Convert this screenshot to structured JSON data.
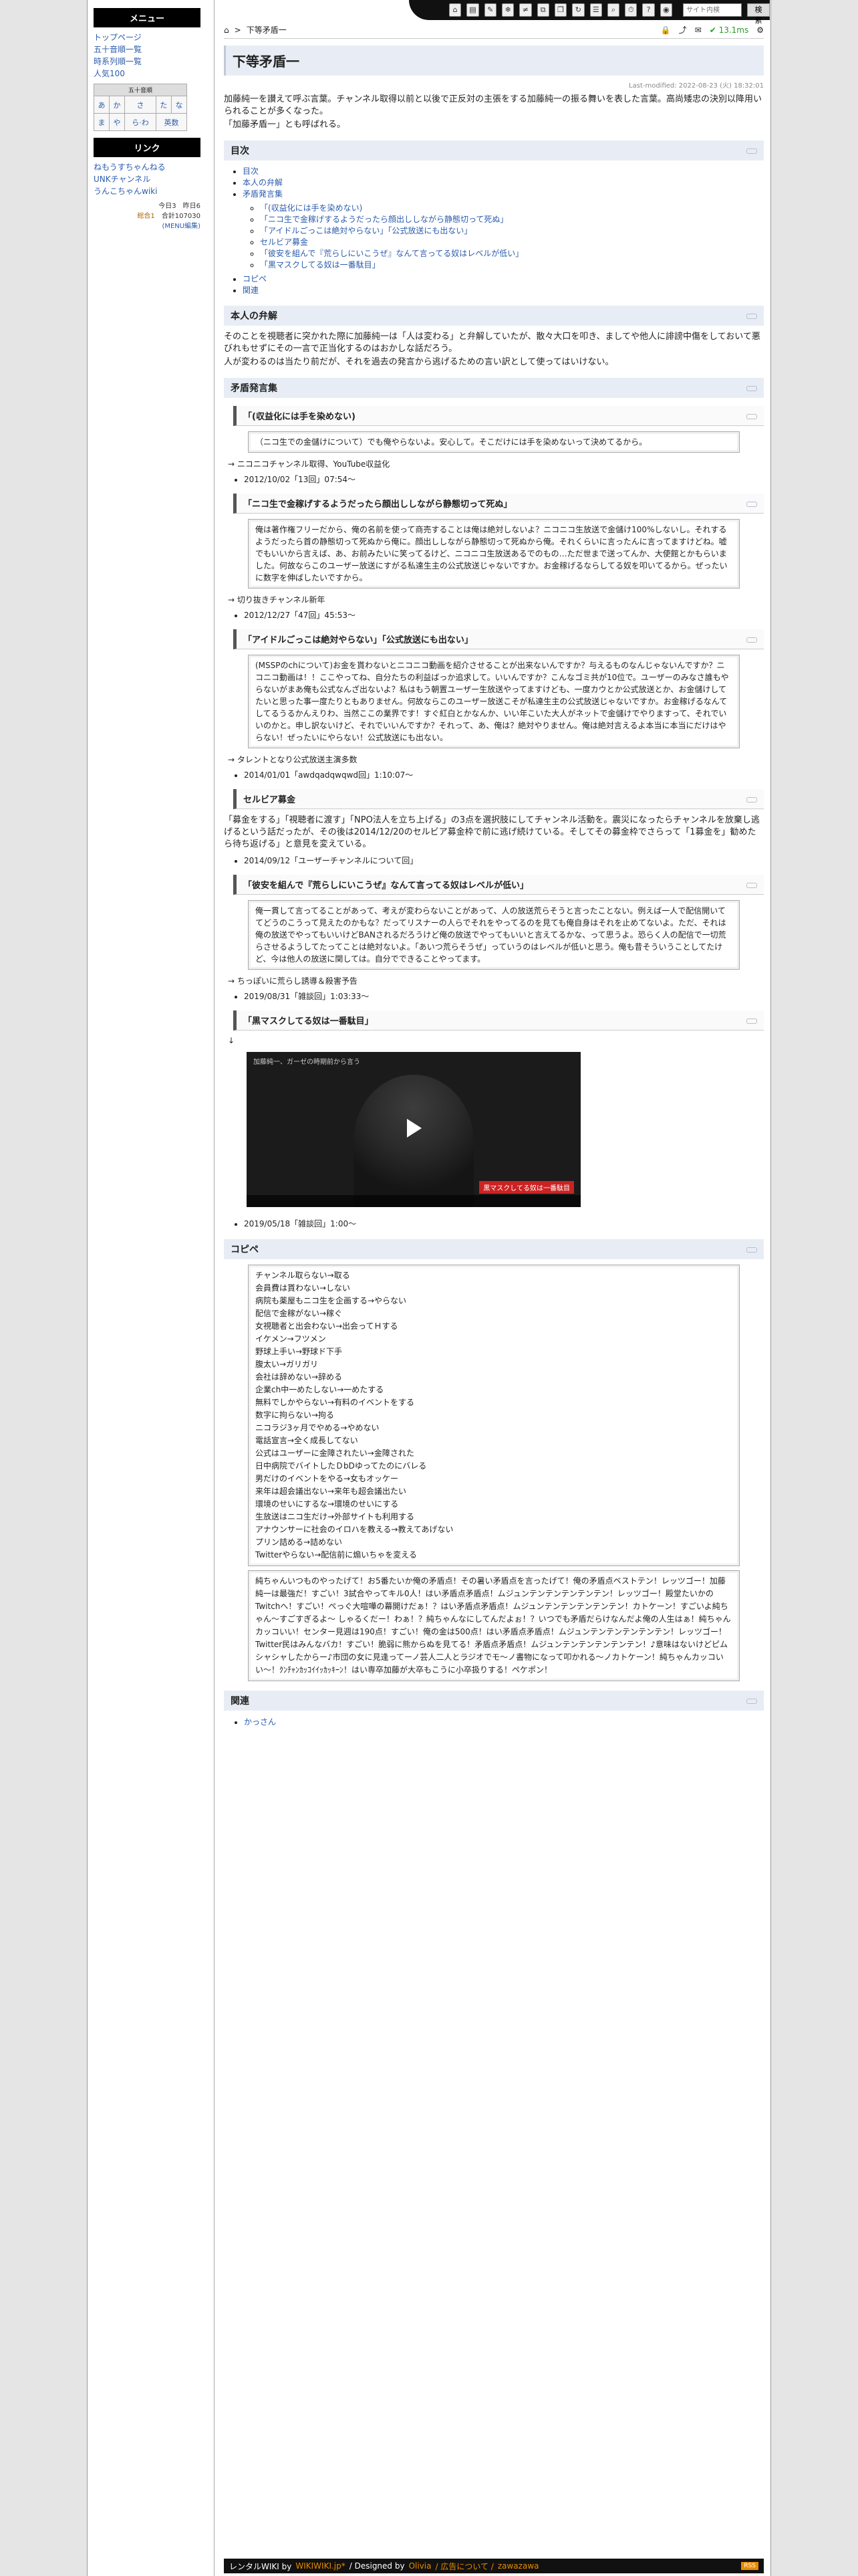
{
  "sidebar": {
    "menu_title": "メニュー",
    "menu_items": [
      "トップページ",
      "五十音順一覧",
      "時系列順一覧",
      "人気100"
    ],
    "kana_caption": "五十音順",
    "kana_rows": [
      [
        "あ",
        "か",
        "さ",
        "た",
        "な"
      ],
      [
        "ま",
        "や",
        "ら·わ",
        "英数"
      ]
    ],
    "links_title": "リンク",
    "link_items": [
      "ねもうすちゃんねる",
      "UNKチャンネル",
      "うんこちゃんwiki"
    ],
    "counter_today": "今日3　昨日6",
    "counter_total_label": "総合1",
    "counter_total": "合計107030",
    "menu_edit": "(MENU編集)"
  },
  "toolbar": {
    "search_placeholder": "サイト内検",
    "search_button": "検索"
  },
  "header": {
    "breadcrumb_sep": ">",
    "breadcrumb_page": "下等矛盾一",
    "response": "13.1ms"
  },
  "page": {
    "title": "下等矛盾一",
    "last_modified": "Last-modified: 2022-08-23 (火) 18:32:01",
    "intro": [
      "加藤純一を讃えて呼ぶ言葉。チャンネル取得以前と以後で正反対の主張をする加藤純一の振る舞いを表した言葉。高尚矮忠の決別以降用いられることが多くなった。",
      "「加藤矛盾一」とも呼ばれる。"
    ]
  },
  "toc": {
    "heading": "目次",
    "items": [
      "目次",
      "本人の弁解",
      "矛盾発言集"
    ],
    "sub_items": [
      "「(収益化には手を染めない)",
      "「ニコ生で金稼げするようだったら顔出ししながら静態切って死ぬ」",
      "「アイドルごっこは絶対やらない」「公式放送にも出ない」",
      "セルビア募金",
      "「彼安を組んで『荒らしにいこうぜ』なんて言ってる奴はレベルが低い」",
      "「黒マスクしてる奴は一番駄目」"
    ],
    "tail_items": [
      "コピペ",
      "関連"
    ]
  },
  "excuse": {
    "heading": "本人の弁解",
    "lines": [
      "そのことを視聴者に突かれた際に加藤純一は「人は変わる」と弁解していたが、散々大口を叩き、ましてや他人に誹謗中傷をしておいて悪びれもせずにその一言で正当化するのはおかしな話だろう。",
      "人が変わるのは当たり前だが、それを過去の発言から逃げるための言い訳として使ってはいけない。"
    ]
  },
  "contradictions": {
    "heading": "矛盾発言集",
    "s1": {
      "title": "「(収益化には手を染めない)",
      "quote": "（ニコ生での金儲けについて）でも俺やらないよ。安心して。そこだけには手を染めないって決めてるから。",
      "note": "→ ニコニコチャンネル取得、YouTube収益化",
      "date": "2012/10/02「13回」07:54〜"
    },
    "s2": {
      "title": "「ニコ生で金稼げするようだったら顔出ししながら静態切って死ぬ」",
      "quote": "俺は著作権フリーだから、俺の名前を使って商売することは俺は絶対しないよ？ニコニコ生放送で金儲け100%しないし。それするようだったら首の静態切って死ぬから俺に。顔出ししながら静態切って死ぬから俺。それくらいに言ったんに言ってますけどね。嘘でもいいから言えば、あ、お前みたいに笑ってるけど、ニコニコ生放送あるでのもの…ただ世まで送ってんか、大使館とかもらいました。何故ならこのユーザー放送にすがる私達生主の公式放送じゃないですか。お金稼げるならしてる奴を叩いてるから。ぜったいに数字を伸ばしたいですから。",
      "note": "→ 切り抜きチャンネル新年",
      "date": "2012/12/27「47回」45:53〜"
    },
    "s3": {
      "title": "「アイドルごっこは絶対やらない」「公式放送にも出ない」",
      "quote": "(MSSPのchについて)お金を貰わないとニコニコ動画を紹介させることが出来ないんですか？与えるものなんじゃないんですか？ニコニコ動画は！！ここやってね、自分たちの利益ばっか追求して。いいんですか？こんなゴミ共が10位で。ユーザーのみなさ誰もやらないがまあ俺も公式なんざ出ないよ？私はもう朝置ユーザー生放送やってますけども、一度カウとか公式放送とか、お金儲けしてたいと思った事一度たりともありません。何故ならこのユーザー放送こそが私達生主の公式放送じゃないですか。お金稼げるなんてしてるうるかんえりわ、当然ここの業界です！すぐ紅白とかなんか、いい年こいた大人がネットで金儲けでやりますって、それでいいのかと。申し訳ないけど、それでいいんですか？それって、あ、俺は？絶対やりません。俺は絶対言えるよ本当に本当にだけはやらない！ぜったいにやらない！公式放送にも出ない。",
      "note": "→ タレントとなり公式放送主演多数",
      "date": "2014/01/01「awdqadqwqwd回」1:10:07〜"
    },
    "s4": {
      "title": "セルビア募金",
      "body": "「募金をする」「視聴者に渡す」「NPO法人を立ち上げる」の3点を選択肢にしてチャンネル活動を。震災になったらチャンネルを放棄し逃げるという話だったが、その後は2014/12/20のセルビア募金枠で前に逃げ続けている。そしてその募金枠でさらって「1募金を」勧めたら待ち返げる」と意見を変えている。",
      "date": "2014/09/12「ユーザーチャンネルについて回」"
    },
    "s5": {
      "title": "「彼安を組んで『荒らしにいこうぜ』なんて言ってる奴はレベルが低い」",
      "quote": "俺一貫して言ってることがあって、考えが変わらないことがあって、人の放送荒らそうと言ったことない。例えば一人で配信開いててどうのこうって見えたのかもな？だってリスナーの人らでそれをやってるのを見ても俺自身はそれを止めてないよ。ただ、それは俺の放送でやってもいいけどBANされるだろうけど俺の放送でやってもいいと言えてるかな、って思うよ。恐らく人の配信で一切荒らさせるようしてたってことは絶対ないよ。「あいつ荒らそうぜ」っていうのはレベルが低いと思う。俺も昔そういうことしてたけど、今は他人の放送に関しては。自分でできることやってます。",
      "note": "→ ちっぽいに荒らし誘導＆殺害予告",
      "date": "2019/08/31「雑談回」1:03:33〜"
    },
    "s6": {
      "title": "「黒マスクしてる奴は一番駄目」",
      "marker": "↓",
      "video_title": "加藤純一、ガーゼの時期前から言う",
      "video_caption": "黒マスクしてる奴は一番駄目",
      "date": "2019/05/18「雑談回」1:00〜"
    }
  },
  "copypasta": {
    "heading": "コピペ",
    "lines": [
      "チャンネル取らない→取る",
      "会員費は貰わない→しない",
      "病院も薬屋もニコ生を企画する→やらない",
      "配信で金稼がない→稼ぐ",
      "女視聴者と出会わない→出会ってＨする",
      "イケメン→フツメン",
      "野球上手い→野球ド下手",
      "腹太い→ガリガリ",
      "会社は辞めない→辞める",
      "企業ch中一めたしない→一めたする",
      "無料でしかやらない→有料のイベントをする",
      "数字に拘らない→拘る",
      "ニコラジ3ヶ月でやめる→やめない",
      "電話宣言→全く成長してない",
      "公式はユーザーに金障されたい→金障された",
      "日中病院でバイトしたＤbDゆってたのにバレる",
      "男だけのイベントをやる→女もオッケー",
      "来年は超会議出ない→来年も超会議出たい",
      "環境のせいにするな→環境のせいにする",
      "生放送はニコ生だけ→外部サイトも利用する",
      "アナウンサーに社会のイロハを教える→教えてあげない",
      "プリン詰める→詰めない",
      "Twitterやらない→配信前に煽いちゃを変える"
    ],
    "box2": "純ちゃんいつものやったげて！お5番たいか俺の矛盾点！その暑い矛盾点を言ったげて！俺の矛盾点ベストテン！レッツゴー！加藤純一は最強だ！すごい！3試合やってキル0人！はい矛盾点矛盾点！ムジュンテンテンテンテンテン！レッツゴー！殿堂たいかのTwitchへ！すごい！ぺっぐ大喧嘩の幕開けだぁ！？はい矛盾点矛盾点！ムジュンテンテンテンテンテン！カトケーン！すごいよ純ちゃん〜すごすぎるよ〜 しゃるくだー！わぁ！？純ちゃんなにしてんだよぉ！？いつでも矛盾だらけなんだよ俺の人生はぁ！純ちゃんカッコいい！センター見週は190点！すごい！俺の金は500点！はい矛盾点矛盾点！ムジュンテンテンテンテンテン！レッツゴー！Twitter民はみんなバカ！すごい！脆弱に熊からぬを見てる！矛盾点矛盾点！ムジュンテンテンテンテンテン！♪意味はないけどピムシャシャしたからー♪市団の女に見逢ってーノ芸人二人とラジオでモ〜ノ書物になって叩かれる〜ノカトケーン！純ちゃんカッコいい〜！ｸﾝﾁｬﾝｶｯｺｲｲｯｶｯｷｰﾝ！はい専卒加藤が大卒もこうに小卒扱りする！ペケポン！"
  },
  "related": {
    "heading": "関連",
    "items": [
      "かっさん"
    ]
  },
  "footer": {
    "rental": "レンタルWIKI by",
    "wikiwiki": "WIKIWIKI.jp*",
    "designed": "/ Designed by",
    "olivia": "Olivia",
    "ads": "/ 広告について /",
    "user": "zawazawa",
    "rss": "RSS"
  }
}
